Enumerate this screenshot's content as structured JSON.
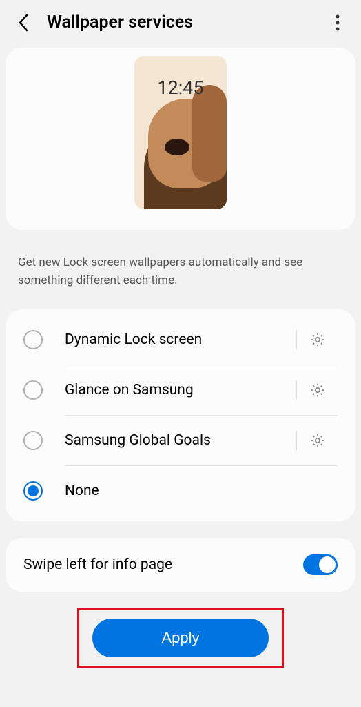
{
  "header": {
    "title": "Wallpaper services"
  },
  "preview": {
    "time": "12:45"
  },
  "description": "Get new Lock screen wallpapers automatically and see something different each time.",
  "options": [
    {
      "label": "Dynamic Lock screen",
      "selected": false,
      "has_gear": true
    },
    {
      "label": "Glance on Samsung",
      "selected": false,
      "has_gear": true
    },
    {
      "label": "Samsung Global Goals",
      "selected": false,
      "has_gear": true
    },
    {
      "label": "None",
      "selected": true,
      "has_gear": false
    }
  ],
  "swipe": {
    "label": "Swipe left for info page",
    "enabled": true
  },
  "apply_label": "Apply"
}
